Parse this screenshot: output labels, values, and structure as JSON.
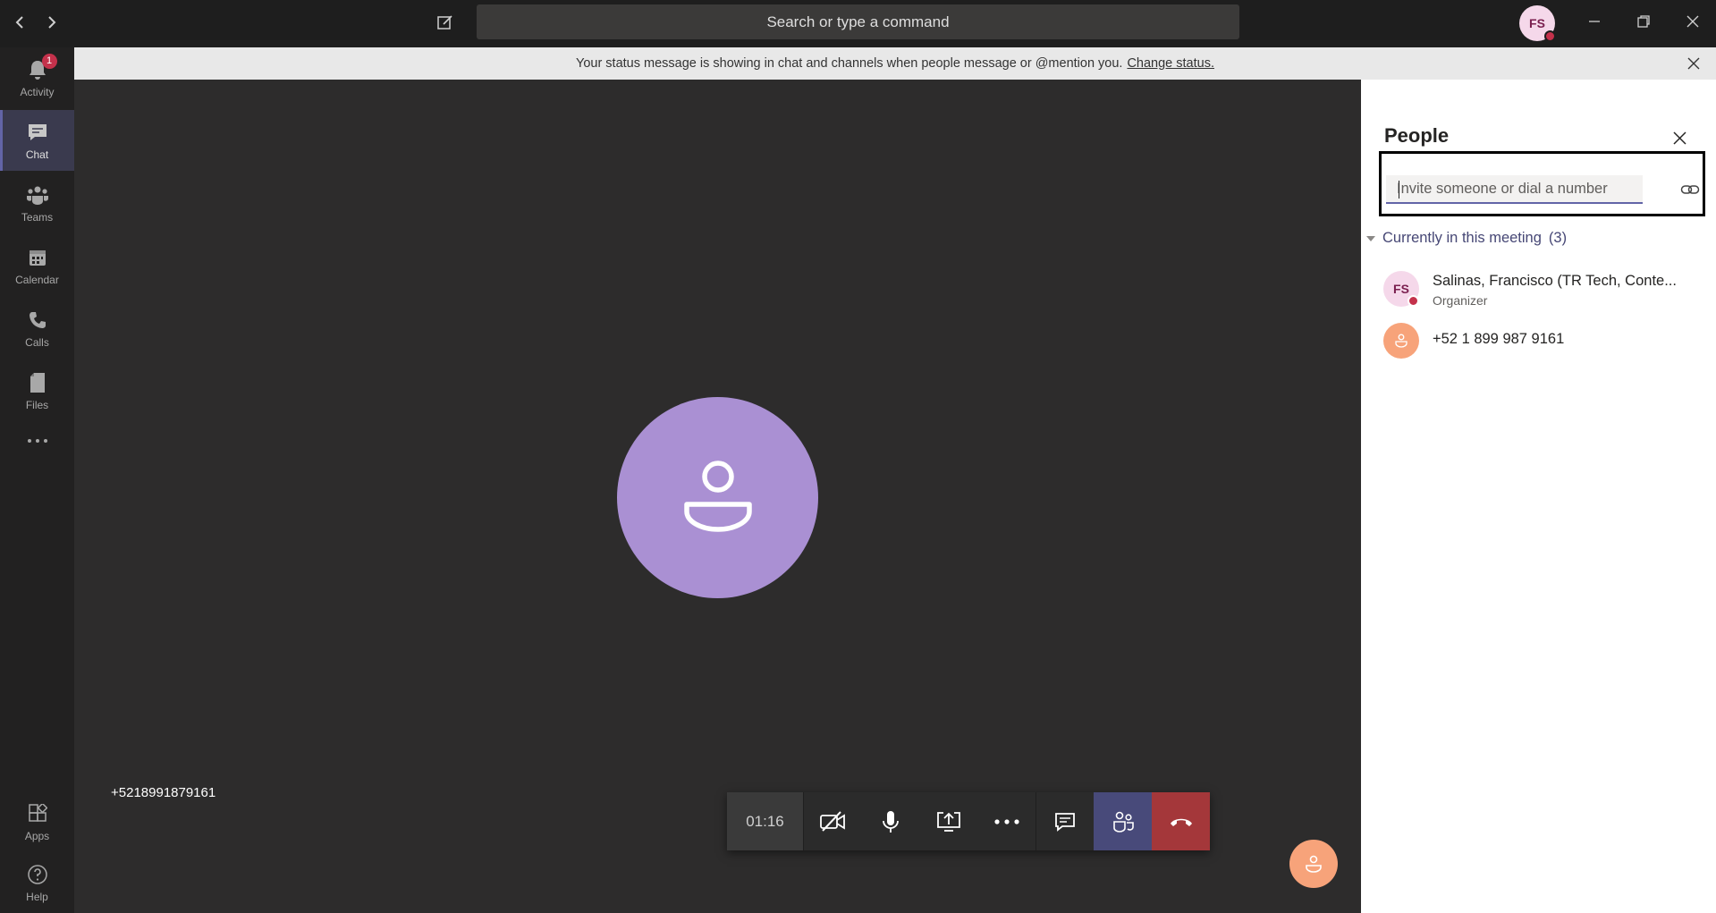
{
  "titlebar": {
    "search_placeholder": "Search or type a command",
    "user_initials": "FS"
  },
  "rail": {
    "items": [
      {
        "label": "Activity",
        "icon": "bell-icon",
        "badge": "1"
      },
      {
        "label": "Chat",
        "icon": "chat-icon",
        "active": true
      },
      {
        "label": "Teams",
        "icon": "teams-icon"
      },
      {
        "label": "Calendar",
        "icon": "calendar-icon"
      },
      {
        "label": "Calls",
        "icon": "phone-icon"
      },
      {
        "label": "Files",
        "icon": "file-icon"
      }
    ],
    "more_icon": "ellipsis-icon",
    "bottom": [
      {
        "label": "Apps",
        "icon": "apps-icon"
      },
      {
        "label": "Help",
        "icon": "help-icon"
      }
    ]
  },
  "banner": {
    "message": "Your status message is showing in chat and channels when people message or @mention you.",
    "link": "Change status."
  },
  "stage": {
    "caller_id": "+5218991879161"
  },
  "controls": {
    "timer": "01:16"
  },
  "people_panel": {
    "title": "People",
    "invite_placeholder": "Invite someone or dial a number",
    "section_label": "Currently in this meeting",
    "section_count": "(3)",
    "participants": [
      {
        "initials": "FS",
        "name": "Salinas, Francisco (TR Tech, Conte...",
        "role": "Organizer"
      },
      {
        "initials": "",
        "name": "+52 1 899 987 9161",
        "role": ""
      }
    ]
  },
  "colors": {
    "accent": "#6264a7",
    "busy": "#c4314b",
    "hangup": "#a4373a",
    "avatar_purple": "#aa90d3",
    "avatar_orange": "#f7a37a"
  }
}
